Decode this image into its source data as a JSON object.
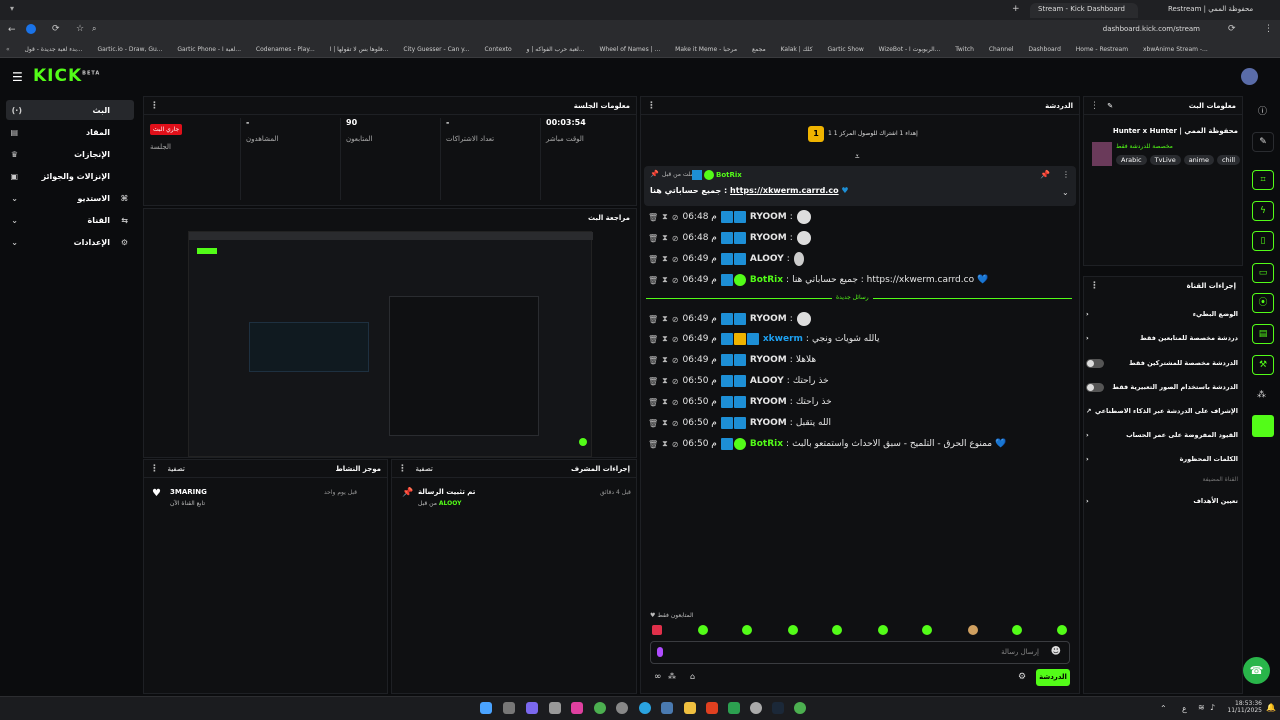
{
  "browser": {
    "tabs": [
      {
        "label": "Stream - Kick Dashboard",
        "active": true
      },
      {
        "label": "Restream | محفوظة الممي",
        "active": false
      }
    ],
    "url": "dashboard.kick.com/stream",
    "bookmarks": [
      "بدء لعبة جديدة - قول...",
      "Gartic.io - Draw, Gu...",
      "Gartic Phone - لعبة ا...",
      "Codenames - Play...",
      "فلوها بس لا تقولها | ا...",
      "City Guesser - Can y...",
      "Contexto",
      "لعبة حرب الفواكه | و...",
      "Wheel of Names | ...",
      "Make it Meme - مرحبا",
      "مجمع",
      "Kalak | كلك",
      "Gartic Show",
      "WizeBot - الربوبوت ا...",
      "Twitch",
      "Channel",
      "Dashboard",
      "Home - Restream",
      "xbwAnime Stream -..."
    ]
  },
  "header": {
    "logo": "KICK",
    "logo_sup": "BETA"
  },
  "sidebar": {
    "items": [
      {
        "label": "البث",
        "icon": "live-icon",
        "selected": true
      },
      {
        "label": "المقاد",
        "icon": "library-icon"
      },
      {
        "label": "الإنجازات",
        "icon": "trophy-icon"
      },
      {
        "label": "الإنزالات والجوائز",
        "icon": "gift-icon"
      },
      {
        "label": "الاستديو",
        "icon": "studio-icon",
        "expand": true
      },
      {
        "label": "القناة",
        "icon": "channel-icon",
        "expand": true
      },
      {
        "label": "الإعدادات",
        "icon": "gear-icon",
        "expand": true
      }
    ]
  },
  "session": {
    "title": "معلومات الجلسة",
    "stats": [
      {
        "value": "00:03:54",
        "label": "الوقت مباشر"
      },
      {
        "value": "-",
        "label": "تعداد الاشتراكات"
      },
      {
        "value": "90",
        "label": "المتابعون"
      },
      {
        "value": "-",
        "label": "المشاهدون"
      },
      {
        "value": "جاري البث",
        "label": "الجلسة"
      }
    ]
  },
  "preview": {
    "title": "مراجعة البث"
  },
  "activity": {
    "title": "موجز النشاط",
    "filter": "تصفية",
    "items": [
      {
        "name": "3MARING",
        "desc": "تابع القناة الآن",
        "time": "قبل يوم واحد"
      }
    ]
  },
  "modactions": {
    "title": "إجراءات المشرف",
    "filter": "تصفية",
    "items": [
      {
        "title": "تم تثبيت الرسالة",
        "by": "من قبل",
        "user": "ALOOY",
        "time": "قبل 4 دقائق"
      }
    ]
  },
  "chat": {
    "title": "الدردشة",
    "top_gifters": "1 إهداء 1 اشتراك للوصول المركز 1",
    "top_rank": "1",
    "pinned": {
      "meta": "أرسلت من قبل",
      "user": "BotRix",
      "message": "جميع حساباتي هنا :",
      "link": "https://xkwerm.carrd.co"
    },
    "new_messages_label": "رسائل جديدة",
    "messages": [
      {
        "time": "06:48 م",
        "user": "RYOOM",
        "color": "#ffffff",
        "text": ""
      },
      {
        "time": "06:48 م",
        "user": "RYOOM",
        "color": "#ffffff",
        "text": ""
      },
      {
        "time": "06:49 م",
        "user": "ALOOY",
        "color": "#ffffff",
        "text": ""
      },
      {
        "time": "06:49 م",
        "user": "BotRix",
        "color": "#53fc18",
        "text": "جميع حساباتي هنا : https://xkwerm.carrd.co 💙"
      },
      {
        "time": "06:49 م",
        "user": "RYOOM",
        "color": "#ffffff",
        "text": ""
      },
      {
        "time": "06:49 م",
        "user": "xkwerm",
        "color": "#1da1f2",
        "text": "يالله شويات ونجي"
      },
      {
        "time": "06:49 م",
        "user": "RYOOM",
        "color": "#ffffff",
        "text": "هلاهلا"
      },
      {
        "time": "06:50 م",
        "user": "ALOOY",
        "color": "#ffffff",
        "text": "خذ راحتك"
      },
      {
        "time": "06:50 م",
        "user": "RYOOM",
        "color": "#ffffff",
        "text": "خذ راحتك"
      },
      {
        "time": "06:50 م",
        "user": "RYOOM",
        "color": "#ffffff",
        "text": "الله يتقبل"
      },
      {
        "time": "06:50 م",
        "user": "BotRix",
        "color": "#53fc18",
        "text": "ممنوع الحرق - التلميح - سبق الاحداث واستمتعو بالبث 💙"
      }
    ],
    "followers_only": "المتابعون فقط",
    "input_placeholder": "إرسال رسالة",
    "send_label": "الدردشة"
  },
  "streaminfo": {
    "title": "معلومات البث",
    "stream_title": "Hunter x Hunter | محفوظة الممي",
    "category": "مخصصة للدردشة فقط",
    "tags": [
      "Arabic",
      "TvLive",
      "anime",
      "chill"
    ]
  },
  "channelactions": {
    "title": "إجراءات القناة",
    "items": [
      {
        "label": "الوضع البطيء",
        "type": "arrow"
      },
      {
        "label": "دردشة مخصصة للمتابعين فقط",
        "type": "arrow"
      },
      {
        "label": "الدردشة مخصصة للمشتركين فقط",
        "type": "toggle"
      },
      {
        "label": "الدردشة باستخدام الصور التعبيرية فقط",
        "type": "toggle"
      },
      {
        "label": "الإشراف على الدردشة عبر الذكاء الاصطناعي",
        "type": "ext"
      },
      {
        "label": "القيود المفروضة على عمر الحساب",
        "type": "arrow"
      },
      {
        "label": "الكلمات المحظورة",
        "type": "arrow"
      }
    ],
    "section_label": "القناة المضيفة",
    "host_item": "تعيين الأهداف"
  },
  "taskbar": {
    "time": "18:53:36",
    "date": "11/11/2025",
    "lang": "ع"
  }
}
